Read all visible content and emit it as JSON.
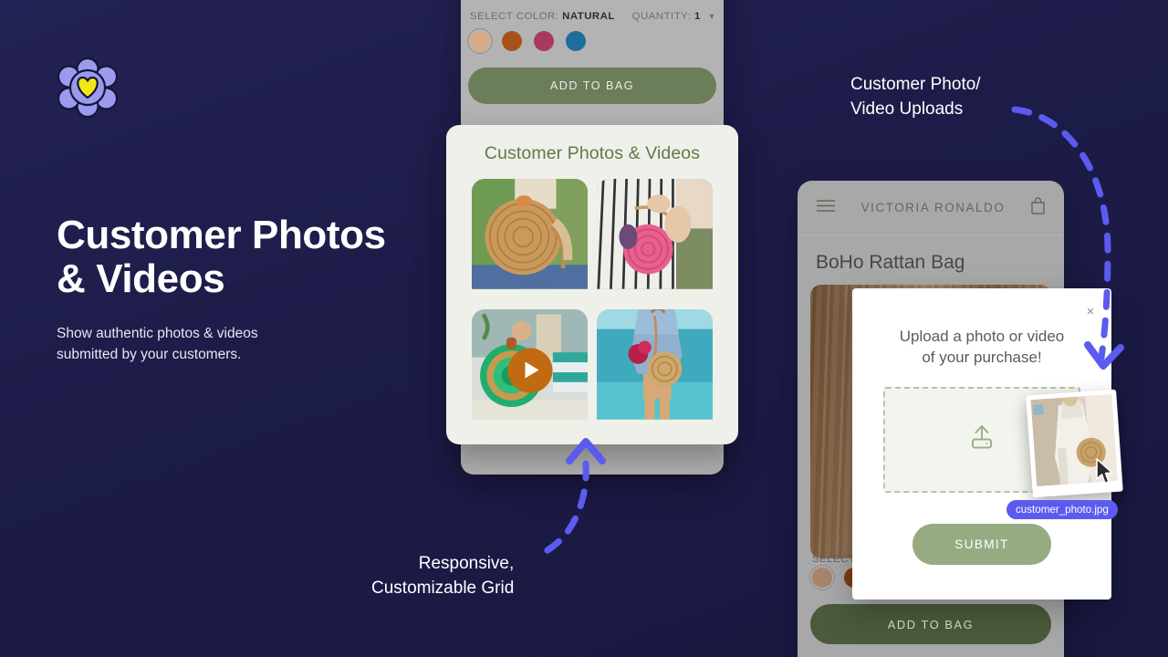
{
  "theme": {
    "background": "#1b1b4d",
    "accent_purple": "#5b5bf0",
    "sage_green": "#96ab82",
    "dark_green": "#4a5a3b",
    "card_cream": "#eef0e9",
    "title_green": "#5f7a4a",
    "logo_petal": "#9a9aee",
    "logo_heart": "#f2e713"
  },
  "left_panel": {
    "logo_name": "flower-heart-logo",
    "title": "Customer Photos\n& Videos",
    "subtitle": "Show authentic photos & videos\nsubmitted by your customers."
  },
  "center_phone": {
    "select_color_label": "SELECT COLOR:",
    "selected_color": "NATURAL",
    "quantity_label": "QUANTITY:",
    "quantity_value": "1",
    "swatches": [
      {
        "name": "natural",
        "hex": "#d6ab86",
        "selected": true
      },
      {
        "name": "rust",
        "hex": "#a8521a",
        "selected": false
      },
      {
        "name": "berry",
        "hex": "#a93a5c",
        "selected": false
      },
      {
        "name": "teal",
        "hex": "#1d6e9c",
        "selected": false
      }
    ],
    "add_to_bag_label": "ADD TO BAG"
  },
  "ugc_card": {
    "title": "Customer Photos & Videos",
    "tiles": [
      {
        "name": "ugc-photo-rattan-bag-hand",
        "is_video": false
      },
      {
        "name": "ugc-photo-pink-bag-stripes",
        "is_video": false
      },
      {
        "name": "ugc-video-green-bag-beach",
        "is_video": true
      },
      {
        "name": "ugc-photo-denim-dress-ocean",
        "is_video": false
      }
    ]
  },
  "right_phone": {
    "menu_icon": "hamburger-menu-icon",
    "brand": "VICTORIA RONALDO",
    "bag_icon": "shopping-bag-icon",
    "product_title": "BoHo Rattan Bag",
    "select_color_label": "SELECT C",
    "swatches": [
      {
        "name": "natural",
        "hex": "#a8846a",
        "selected": true
      },
      {
        "name": "rust",
        "hex": "#7d3c12",
        "selected": false
      }
    ],
    "add_to_bag_label": "ADD TO BAG"
  },
  "upload_modal": {
    "close_label": "×",
    "title": "Upload a photo or video\nof your purchase!",
    "dropzone_icon": "upload-icon",
    "submit_label": "SUBMIT",
    "file_name": "customer_photo.jpg",
    "thumb_name": "uploaded-photo-thumbnail",
    "cursor_name": "mouse-cursor"
  },
  "annotations": [
    {
      "name": "annotation-upload",
      "text": "Customer Photo/\nVideo Uploads"
    },
    {
      "name": "annotation-grid",
      "text": "Responsive,\nCustomizable Grid"
    }
  ]
}
